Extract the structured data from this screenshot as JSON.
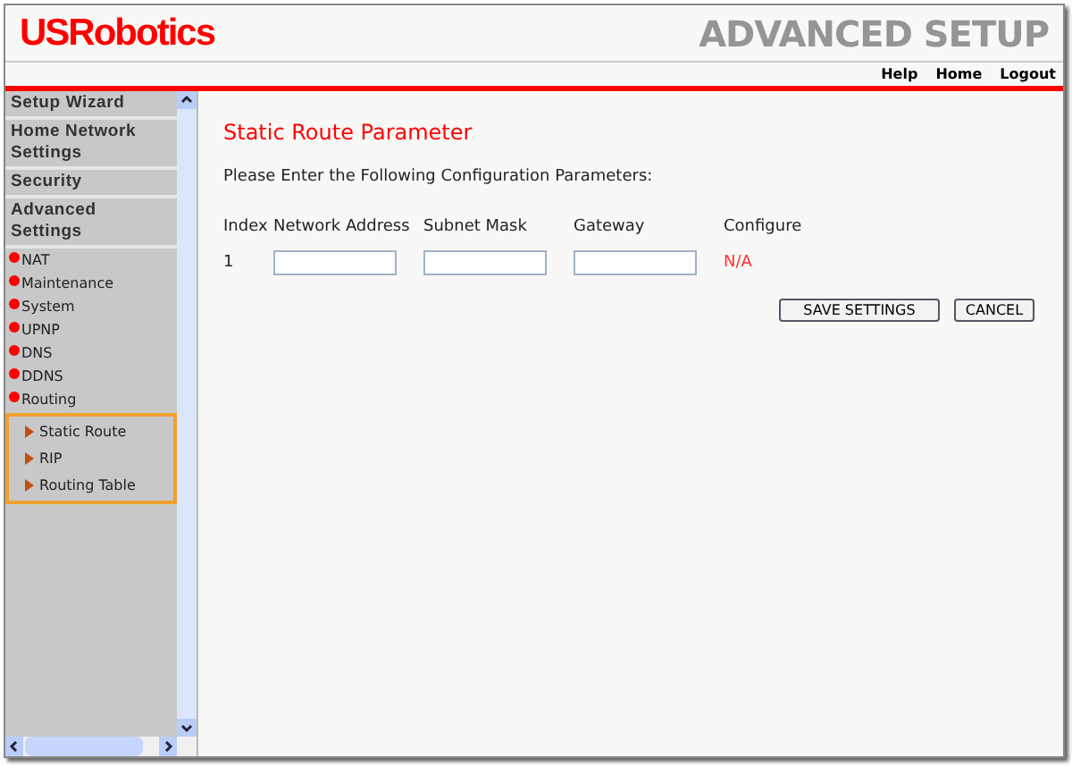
{
  "header": {
    "logo": "USRobotics",
    "title": "ADVANCED SETUP"
  },
  "top_links": [
    "Help",
    "Home",
    "Logout"
  ],
  "sidebar": {
    "sections": [
      {
        "label": "Setup Wizard"
      },
      {
        "label": "Home Network Settings"
      },
      {
        "label": "Security"
      },
      {
        "label": "Advanced Settings"
      }
    ],
    "items": [
      {
        "label": "NAT"
      },
      {
        "label": "Maintenance"
      },
      {
        "label": "System"
      },
      {
        "label": "UPNP"
      },
      {
        "label": "DNS"
      },
      {
        "label": "DDNS"
      },
      {
        "label": "Routing",
        "expanded": true,
        "children": [
          {
            "label": "Static Route"
          },
          {
            "label": "RIP"
          },
          {
            "label": "Routing Table"
          }
        ]
      }
    ]
  },
  "content": {
    "title": "Static Route Parameter",
    "instructions": "Please Enter the Following Configuration Parameters:",
    "table": {
      "columns": [
        "Index",
        "Network Address",
        "Subnet Mask",
        "Gateway",
        "Configure"
      ],
      "rows": [
        {
          "index": "1",
          "configure": "N/A"
        }
      ]
    },
    "buttons": [
      "SAVE SETTINGS",
      "CANCEL"
    ]
  }
}
